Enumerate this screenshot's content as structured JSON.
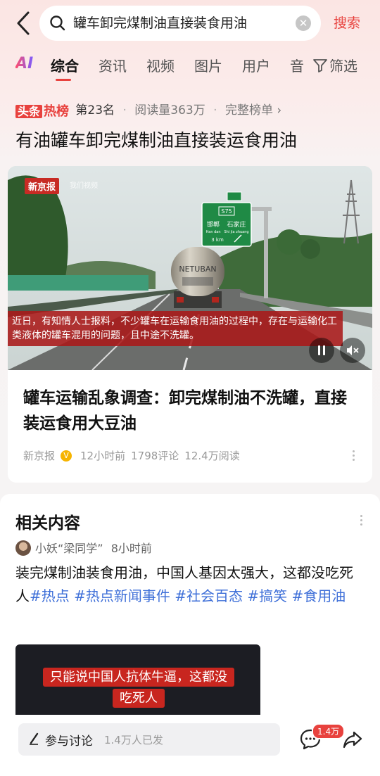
{
  "search": {
    "query": "罐车卸完煤制油直接装食用油",
    "submit_label": "搜索"
  },
  "tabs": {
    "ai_label": "AI",
    "items": [
      "综合",
      "资讯",
      "视频",
      "图片",
      "用户",
      "音"
    ],
    "active": "综合",
    "filter_label": "筛选"
  },
  "hot_rank": {
    "logo_part1": "头条",
    "logo_part2": "热榜",
    "rank": "第23名",
    "reads": "阅读量363万",
    "full_list": "完整榜单 ›"
  },
  "headline": "有油罐车卸完煤制油直接装运食用油",
  "video_card": {
    "source_logo": "新京报",
    "source_sub": "我们视频",
    "caption": "近日，有知情人士报料，不少罐车在运输食用油的过程中，存在与运输化工类液体的罐车混用的问题，且中途不洗罐。",
    "sign_route": "S75",
    "sign_city1": "邯郸",
    "sign_city2": "石家庄",
    "sign_pinyin1": "Han dan",
    "sign_pinyin2": "Shi jia zhuang",
    "sign_distance": "3 km",
    "truck_text": "NETUBAN",
    "title": "罐车运输乱象调查：卸完煤制油不洗罐，直接装运食用大豆油",
    "source": "新京报",
    "time": "12小时前",
    "comments": "1798评论",
    "reads": "12.4万阅读"
  },
  "related": {
    "title": "相关内容",
    "author": "小妖“梁同学”",
    "time": "8小时前",
    "text": "装完煤制油装食用油，中国人基因太强大，这都没吃死人",
    "hashtags": [
      "#热点",
      "#热点新闻事件",
      "#社会百态",
      "#搞笑",
      "#食用油"
    ],
    "thumb_text": "只能说中国人抗体牛逼，这都没吃死人"
  },
  "bottom": {
    "discuss_label": "参与讨论",
    "discuss_count": "1.4万人已发",
    "comment_badge": "1.4万"
  },
  "colors": {
    "accent": "#e8423e",
    "hashtag": "#3e6fd8",
    "caption_bg": "#aa1919"
  }
}
